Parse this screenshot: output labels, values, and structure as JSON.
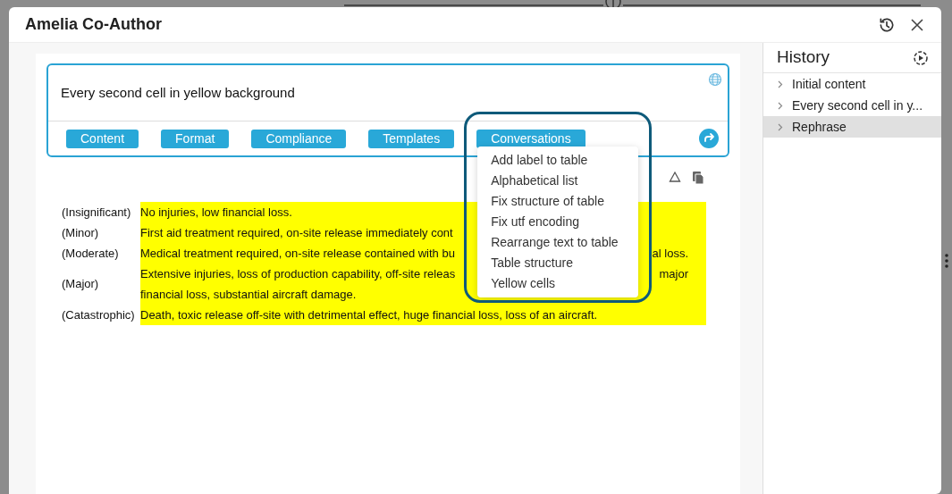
{
  "window": {
    "title": "Amelia Co-Author"
  },
  "prompt": {
    "value": "Every second cell in yellow background"
  },
  "categories": [
    {
      "label": "Content",
      "selected": false
    },
    {
      "label": "Format",
      "selected": false
    },
    {
      "label": "Compliance",
      "selected": false
    },
    {
      "label": "Templates",
      "selected": false
    },
    {
      "label": "Conversations",
      "selected": true
    }
  ],
  "menu": {
    "items": [
      "Add label to table",
      "Alphabetical list",
      "Fix structure of table",
      "Fix utf encoding",
      "Rearrange text to table",
      "Table structure",
      "Yellow cells"
    ]
  },
  "table": {
    "rows": [
      {
        "label": "(Insignificant)",
        "lines": [
          {
            "text": "No injuries, low financial loss."
          }
        ]
      },
      {
        "label": "(Minor)",
        "lines": [
          {
            "text": "First aid treatment required, on-site release immediately cont"
          }
        ]
      },
      {
        "label": "(Moderate)",
        "lines": [
          {
            "text": "Medical treatment required, on-site release contained with bu",
            "after": "al loss."
          }
        ]
      },
      {
        "label": "(Major)",
        "lines": [
          {
            "text": "Extensive injuries, loss of production capability, off-site releas",
            "after": "major"
          },
          {
            "text": "financial loss, substantial aircraft damage."
          }
        ]
      },
      {
        "label": "(Catastrophic)",
        "lines": [
          {
            "text": "Death, toxic release off-site with detrimental effect, huge financial loss, loss of an aircraft."
          }
        ]
      }
    ]
  },
  "history": {
    "title": "History",
    "items": [
      {
        "label": "Initial content",
        "selected": false
      },
      {
        "label": "Every second cell in y...",
        "selected": false
      },
      {
        "label": "Rephrase",
        "selected": true
      }
    ]
  }
}
